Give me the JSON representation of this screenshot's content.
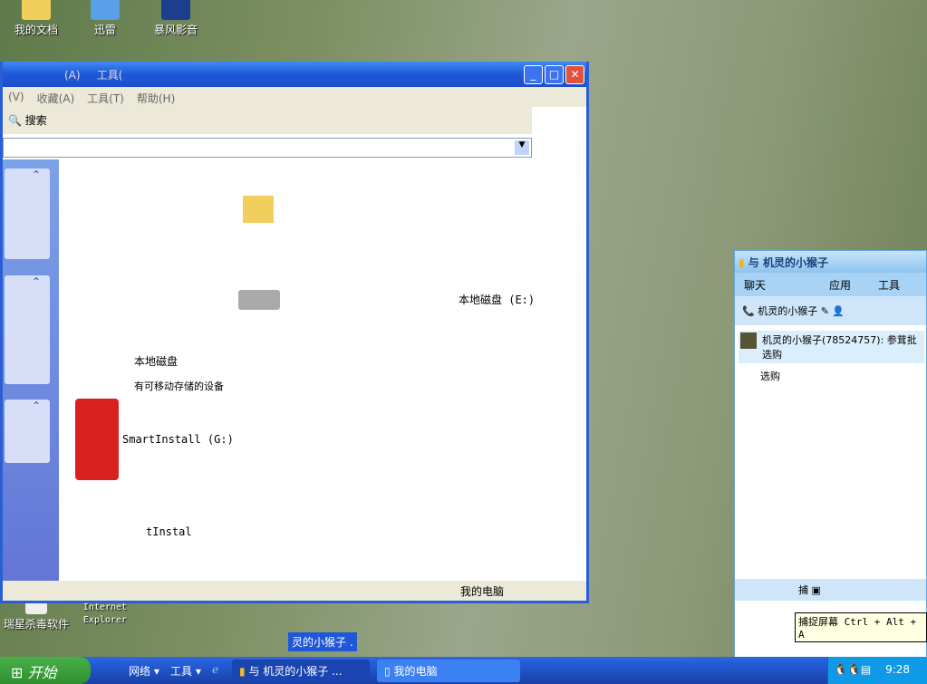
{
  "desktop": {
    "icons": [
      {
        "label": "我的文档",
        "name": "my-documents"
      },
      {
        "label": "迅雷",
        "name": "xunlei"
      },
      {
        "label": "暴风影音",
        "name": "baofeng"
      },
      {
        "label": "瑞星杀毒软件",
        "name": "rising-antivirus"
      },
      {
        "label": "Internet Explorer",
        "name": "internet-explorer"
      }
    ]
  },
  "explorer": {
    "title": "我的电脑",
    "menu_top": [
      "(A)",
      "工具("
    ],
    "menu": [
      "(V)",
      "收藏(A)",
      "工具(T)",
      "帮助(H)"
    ],
    "search_label": "搜索",
    "items": [
      "SmartInstall (G:)",
      "本地磁盘 (E:)",
      "本地磁盘",
      "有可移动存储的设备",
      "tInstal"
    ],
    "status": "我的电脑"
  },
  "qq": {
    "title": "与 机灵的小猴子",
    "tabs": [
      "聊天",
      "应用",
      "工具"
    ],
    "contact": "机灵的小猴子",
    "message_header": "机灵的小猴子(78524757): 参茸批",
    "message_body": "选购",
    "tooltip": "捕捉屏幕 Ctrl + Alt + A",
    "capture_label": "捕"
  },
  "taskbar": {
    "start": "开始",
    "toolbars": [
      "网络",
      "工具"
    ],
    "items": [
      "与 机灵的小猴子 ...",
      "我的电脑"
    ],
    "clock": "9:28",
    "floating": "灵的小猴子 ."
  },
  "colors": {
    "taskbar": "#245edb",
    "start": "#3c9a3c",
    "titlebar": "#2057d8"
  }
}
